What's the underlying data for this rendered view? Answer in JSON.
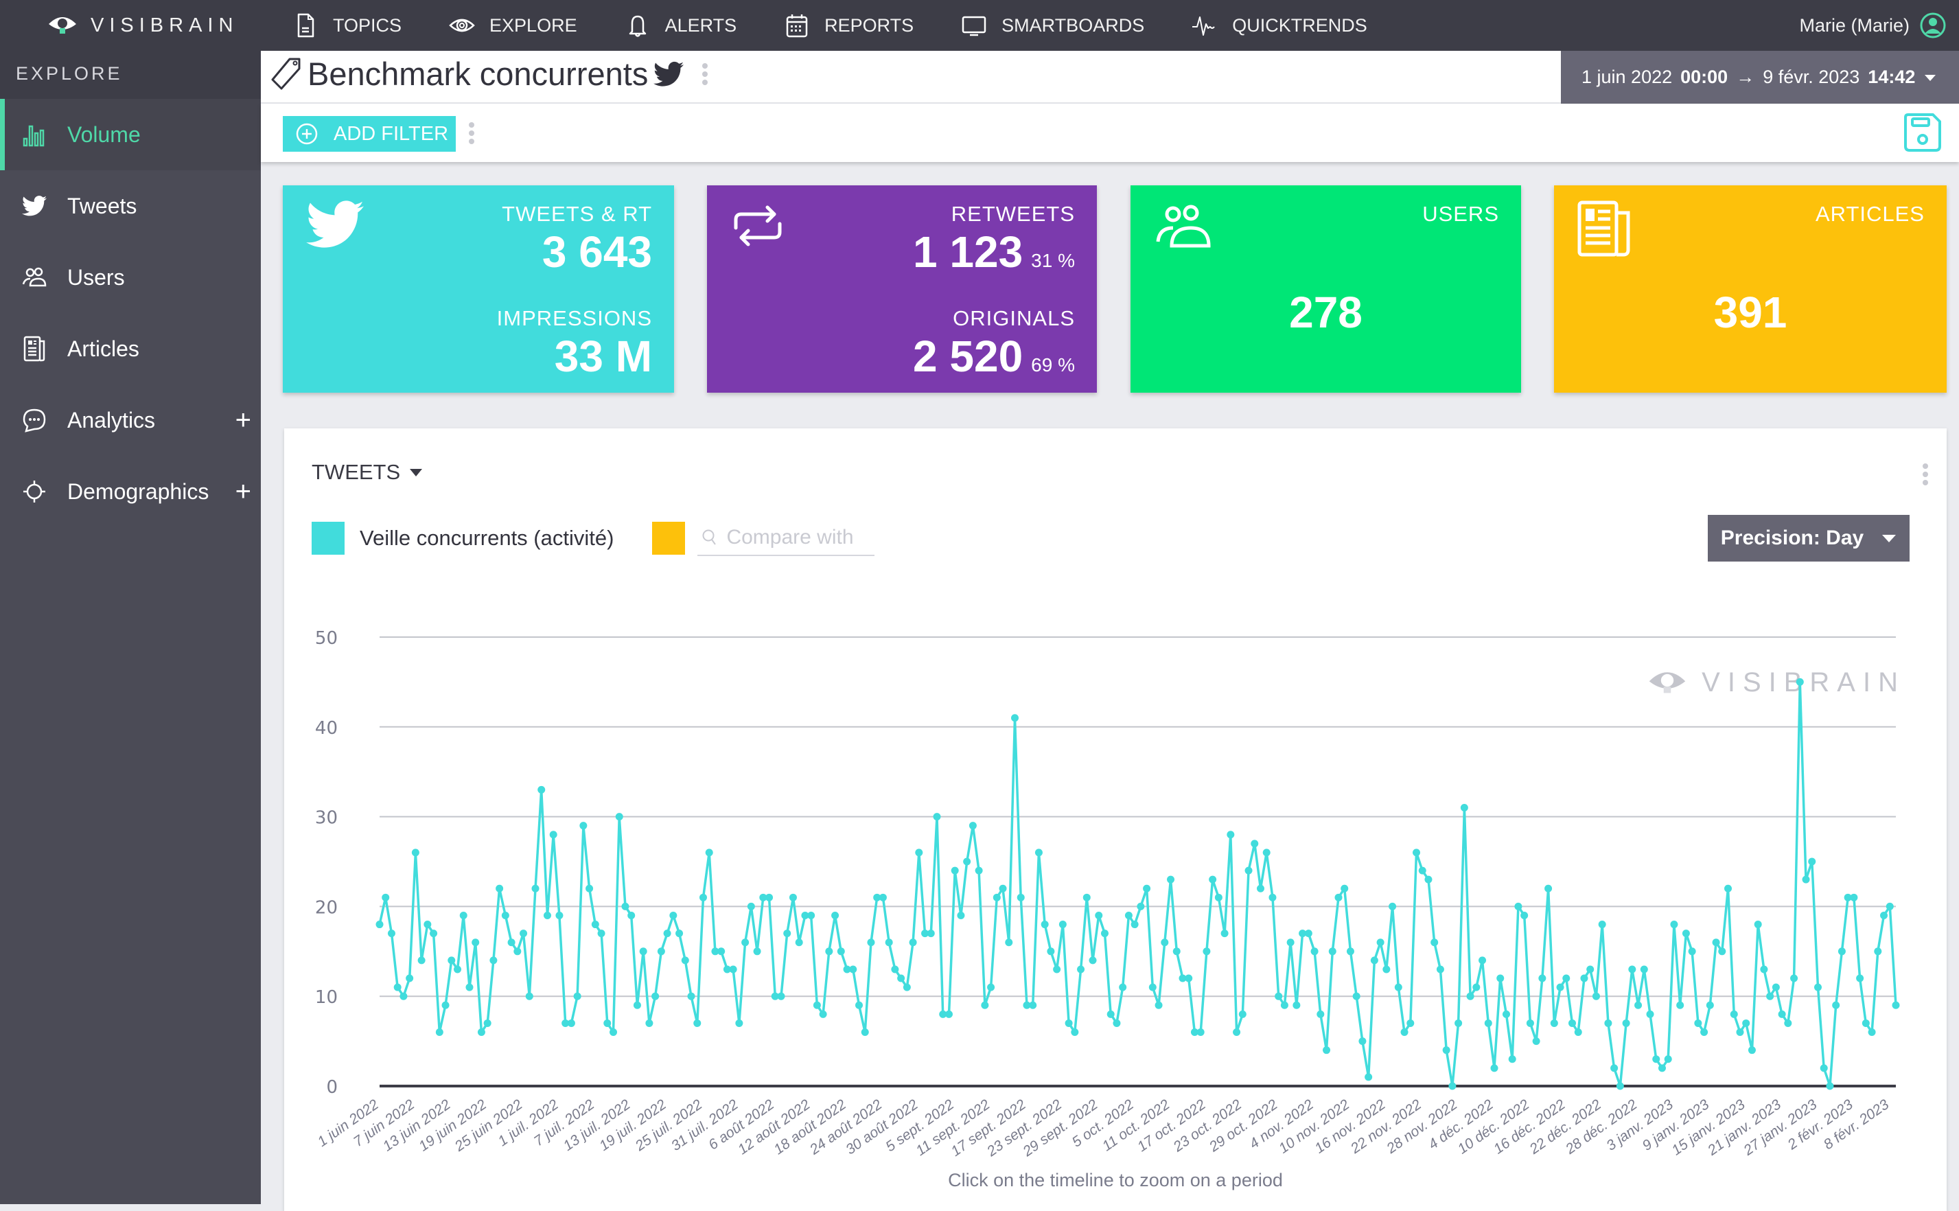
{
  "topbar": {
    "brand": "VISIBRAIN",
    "nav": [
      {
        "label": "TOPICS",
        "icon": "document-icon"
      },
      {
        "label": "EXPLORE",
        "icon": "eye-icon"
      },
      {
        "label": "ALERTS",
        "icon": "bell-icon"
      },
      {
        "label": "REPORTS",
        "icon": "calendar-icon"
      },
      {
        "label": "SMARTBOARDS",
        "icon": "monitor-icon"
      },
      {
        "label": "QUICKTRENDS",
        "icon": "pulse-icon"
      }
    ],
    "user": "Marie (Marie)"
  },
  "sidebar": {
    "header": "EXPLORE",
    "items": [
      {
        "label": "Volume",
        "icon": "bar-chart-icon",
        "active": true
      },
      {
        "label": "Tweets",
        "icon": "twitter-icon"
      },
      {
        "label": "Users",
        "icon": "users-icon"
      },
      {
        "label": "Articles",
        "icon": "newspaper-icon"
      },
      {
        "label": "Analytics",
        "icon": "chat-icon",
        "expandable": "+"
      },
      {
        "label": "Demographics",
        "icon": "crosshair-icon",
        "expandable": "+"
      }
    ]
  },
  "titlebar": {
    "title": "Benchmark concurrents",
    "date_from": "1 juin 2022",
    "time_from": "00:00",
    "arrow": "→",
    "date_to": "9 févr. 2023",
    "time_to": "14:42"
  },
  "filterbar": {
    "add_filter": "ADD FILTER"
  },
  "cards": {
    "tweets": {
      "label": "TWEETS & RT",
      "value": "3 643",
      "label2": "IMPRESSIONS",
      "value2": "33 M",
      "color": "#41dcdc"
    },
    "retweets": {
      "label": "RETWEETS",
      "value": "1 123",
      "pct": "31 %",
      "label2": "ORIGINALS",
      "value2": "2 520",
      "pct2": "69 %",
      "color": "#7b3aad"
    },
    "users": {
      "label": "USERS",
      "value": "278",
      "color": "#00e676"
    },
    "articles": {
      "label": "ARTICLES",
      "value": "391",
      "color": "#fdc10b"
    }
  },
  "panel": {
    "title": "TWEETS",
    "legend_series": "Veille concurrents (activité)",
    "series_color": "#41dcdc",
    "compare_color": "#fdc10b",
    "compare_placeholder": "Compare with",
    "precision": "Precision: Day",
    "watermark": "VISIBRAIN",
    "hint": "Click on the timeline to zoom on a period"
  },
  "chart_data": {
    "type": "line",
    "title": "TWEETS",
    "xlabel": "",
    "ylabel": "",
    "ylim": [
      0,
      50
    ],
    "yticks": [
      0,
      10,
      20,
      30,
      40,
      50
    ],
    "grid": true,
    "x_start": "1 juin 2022",
    "x_end": "9 févr. 2023",
    "x_interval_days": 1,
    "xtick_labels": [
      "1 juin 2022",
      "7 juin 2022",
      "13 juin 2022",
      "19 juin 2022",
      "25 juin 2022",
      "1 juil. 2022",
      "7 juil. 2022",
      "13 juil. 2022",
      "19 juil. 2022",
      "25 juil. 2022",
      "31 juil. 2022",
      "6 août 2022",
      "12 août 2022",
      "18 août 2022",
      "24 août 2022",
      "30 août 2022",
      "5 sept. 2022",
      "11 sept. 2022",
      "17 sept. 2022",
      "23 sept. 2022",
      "29 sept. 2022",
      "5 oct. 2022",
      "11 oct. 2022",
      "17 oct. 2022",
      "23 oct. 2022",
      "29 oct. 2022",
      "4 nov. 2022",
      "10 nov. 2022",
      "16 nov. 2022",
      "22 nov. 2022",
      "28 nov. 2022",
      "4 déc. 2022",
      "10 déc. 2022",
      "16 déc. 2022",
      "22 déc. 2022",
      "28 déc. 2022",
      "3 janv. 2023",
      "9 janv. 2023",
      "15 janv. 2023",
      "21 janv. 2023",
      "27 janv. 2023",
      "2 févr. 2023",
      "8 févr. 2023"
    ],
    "xtick_every_days": 6,
    "series": [
      {
        "name": "Veille concurrents (activité)",
        "color": "#41dcdc",
        "values": [
          18,
          21,
          17,
          11,
          10,
          12,
          26,
          14,
          18,
          17,
          6,
          9,
          14,
          13,
          19,
          11,
          16,
          6,
          7,
          14,
          22,
          19,
          16,
          15,
          17,
          10,
          22,
          33,
          19,
          28,
          19,
          7,
          7,
          10,
          29,
          22,
          18,
          17,
          7,
          6,
          30,
          20,
          19,
          9,
          15,
          7,
          10,
          15,
          17,
          19,
          17,
          14,
          10,
          7,
          21,
          26,
          15,
          15,
          13,
          13,
          7,
          16,
          20,
          15,
          21,
          21,
          10,
          10,
          17,
          21,
          16,
          19,
          19,
          9,
          8,
          15,
          19,
          15,
          13,
          13,
          9,
          6,
          16,
          21,
          21,
          16,
          13,
          12,
          11,
          16,
          26,
          17,
          17,
          30,
          8,
          8,
          24,
          19,
          25,
          29,
          24,
          9,
          11,
          21,
          22,
          16,
          41,
          21,
          9,
          9,
          26,
          18,
          15,
          13,
          18,
          7,
          6,
          13,
          21,
          14,
          19,
          17,
          8,
          7,
          11,
          19,
          18,
          20,
          22,
          11,
          9,
          16,
          23,
          15,
          12,
          12,
          6,
          6,
          15,
          23,
          21,
          17,
          28,
          6,
          8,
          24,
          27,
          22,
          26,
          21,
          10,
          9,
          16,
          9,
          17,
          17,
          15,
          8,
          4,
          15,
          21,
          22,
          15,
          10,
          5,
          1,
          14,
          16,
          13,
          20,
          11,
          6,
          7,
          26,
          24,
          23,
          16,
          13,
          4,
          0,
          7,
          31,
          10,
          11,
          14,
          7,
          2,
          12,
          8,
          3,
          20,
          19,
          7,
          5,
          12,
          22,
          7,
          11,
          12,
          7,
          6,
          12,
          13,
          10,
          18,
          7,
          2,
          0,
          7,
          13,
          9,
          13,
          8,
          3,
          2,
          3,
          18,
          9,
          17,
          15,
          7,
          6,
          9,
          16,
          15,
          22,
          8,
          6,
          7,
          4,
          18,
          13,
          10,
          11,
          8,
          7,
          12,
          45,
          23,
          25,
          11,
          2,
          0,
          9,
          15,
          21,
          21,
          12,
          7,
          6,
          15,
          19,
          20,
          9
        ]
      }
    ]
  }
}
